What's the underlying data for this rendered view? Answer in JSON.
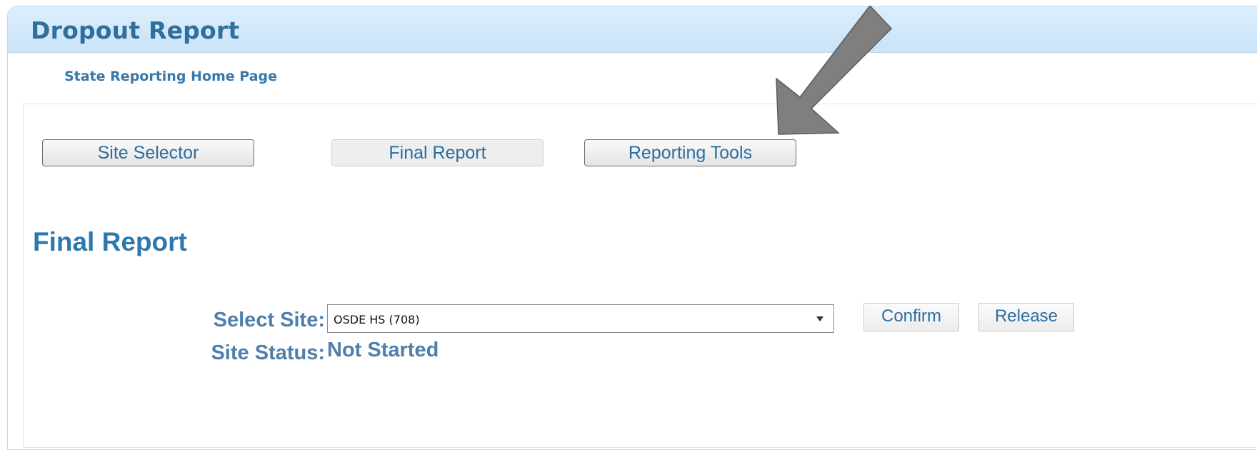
{
  "header": {
    "title": "Dropout Report"
  },
  "nav": {
    "home_link": "State Reporting Home Page"
  },
  "tabs": [
    {
      "label": "Site Selector",
      "active": false
    },
    {
      "label": "Final Report",
      "active": true
    },
    {
      "label": "Reporting Tools",
      "active": false
    }
  ],
  "section": {
    "title": "Final Report"
  },
  "form": {
    "select_site_label": "Select Site:",
    "select_site_value": "OSDE HS (708)",
    "confirm_label": "Confirm",
    "release_label": "Release",
    "site_status_label": "Site Status:",
    "site_status_value": "Not Started"
  },
  "annotation": {
    "icon": "arrow-pointing-at-reporting-tools",
    "color": "#7f7f7f"
  },
  "colors": {
    "header_bg": "#c9e3f8",
    "title_text": "#2e6f9e",
    "link_text": "#3a78a8",
    "label_text": "#4f7faa"
  }
}
